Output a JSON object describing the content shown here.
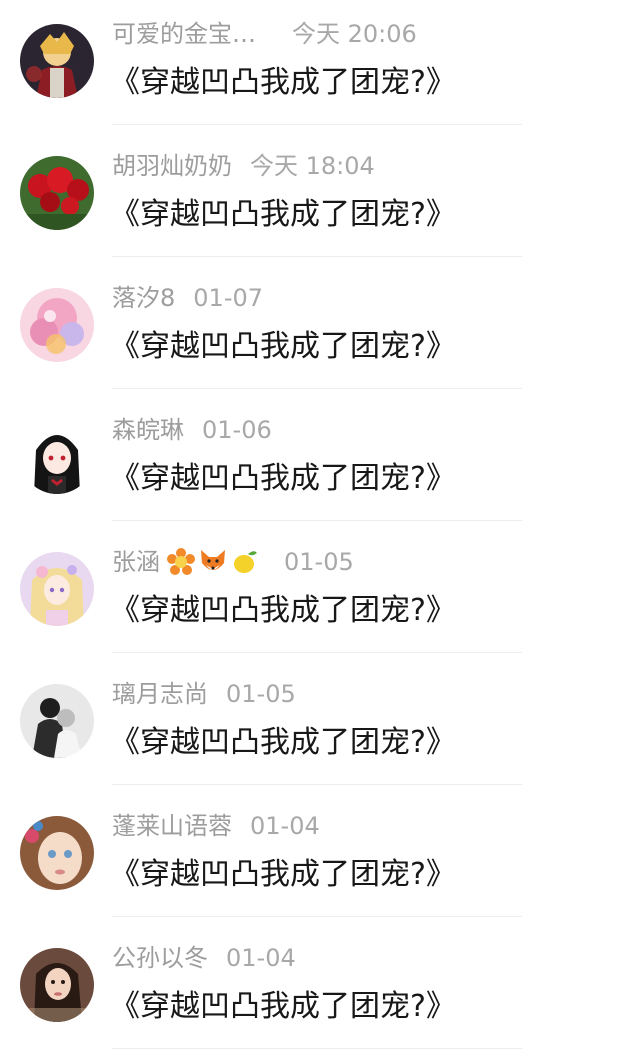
{
  "comments": [
    {
      "username": "可爱的金宝…",
      "time": "今天 20:06",
      "message": "《穿越凹凸我成了团宠?》",
      "avatar": "anime-boy-gold-hair-avatar"
    },
    {
      "username": "胡羽灿奶奶",
      "time": "今天 18:04",
      "message": "《穿越凹凸我成了团宠?》",
      "avatar": "red-roses-avatar"
    },
    {
      "username": "落汐8",
      "time": "01-07",
      "message": "《穿越凹凸我成了团宠?》",
      "avatar": "pink-blurry-anime-avatar"
    },
    {
      "username": "森皖琳",
      "time": "01-06",
      "message": "《穿越凹凸我成了团宠?》",
      "avatar": "anime-girl-black-hair-avatar"
    },
    {
      "username": "张涵",
      "time": "01-05",
      "message": "《穿越凹凸我成了团宠?》",
      "avatar": "anime-girl-blonde-avatar",
      "badges": [
        "flower-emoji",
        "fox-emoji",
        "lemon-emoji"
      ]
    },
    {
      "username": "璃月志尚",
      "time": "01-05",
      "message": "《穿越凹凸我成了团宠?》",
      "avatar": "black-white-couple-avatar"
    },
    {
      "username": "蓬莱山语蓉",
      "time": "01-04",
      "message": "《穿越凹凸我成了团宠?》",
      "avatar": "doll-face-avatar"
    },
    {
      "username": "公孙以冬",
      "time": "01-04",
      "message": "《穿越凹凸我成了团宠?》",
      "avatar": "long-hair-girl-avatar"
    }
  ]
}
